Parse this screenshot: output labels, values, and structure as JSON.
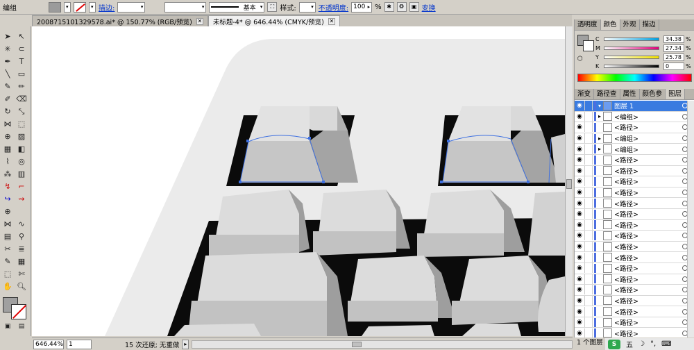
{
  "control_bar": {
    "selection_label": "编组",
    "stroke_label": "描边:",
    "stroke_profile": "基本",
    "style_label": "样式:",
    "opacity_label": "不透明度:",
    "opacity_value": "100",
    "percent": "%",
    "transform_label": "变换"
  },
  "doc_tabs": [
    {
      "title": "2008715101329578.ai* @ 150.77% (RGB/预览)",
      "active": false
    },
    {
      "title": "未标题-4* @ 646.44% (CMYK/预览)",
      "active": true
    }
  ],
  "color_panel": {
    "tabs": [
      "透明度",
      "颜色",
      "外观",
      "描边"
    ],
    "active_tab": "颜色",
    "channels": [
      {
        "name": "C",
        "value": "34.38",
        "color": "#00a0e0"
      },
      {
        "name": "M",
        "value": "27.34",
        "color": "#e0007a"
      },
      {
        "name": "Y",
        "value": "25.78",
        "color": "#f0e000"
      },
      {
        "name": "K",
        "value": "0",
        "color": "#000000"
      }
    ],
    "pct": "%"
  },
  "layers_panel": {
    "tabs": [
      "渐变",
      "路径查",
      "属性",
      "颜色参",
      "图层"
    ],
    "active_tab": "图层",
    "rows": [
      {
        "name": "图层 1",
        "selected": true
      },
      {
        "name": "<编组>",
        "selected": false
      },
      {
        "name": "<路径>",
        "selected": false
      },
      {
        "name": "<编组>",
        "selected": false
      },
      {
        "name": "<编组>",
        "selected": false
      },
      {
        "name": "<路径>",
        "selected": false
      },
      {
        "name": "<路径>",
        "selected": false
      },
      {
        "name": "<路径>",
        "selected": false
      },
      {
        "name": "<路径>",
        "selected": false
      },
      {
        "name": "<路径>",
        "selected": false
      },
      {
        "name": "<路径>",
        "selected": false
      },
      {
        "name": "<路径>",
        "selected": false
      },
      {
        "name": "<路径>",
        "selected": false
      },
      {
        "name": "<路径>",
        "selected": false
      },
      {
        "name": "<路径>",
        "selected": false
      },
      {
        "name": "<路径>",
        "selected": false
      },
      {
        "name": "<路径>",
        "selected": false
      },
      {
        "name": "<路径>",
        "selected": false
      },
      {
        "name": "<路径>",
        "selected": false
      },
      {
        "name": "<路径>",
        "selected": false
      },
      {
        "name": "<路径>",
        "selected": false
      },
      {
        "name": "<路径>",
        "selected": false
      }
    ],
    "footer": "1 个图层"
  },
  "status_bar": {
    "zoom": "646.44%",
    "page": "1",
    "history": "15 次还原; 无重做"
  },
  "ime": {
    "logo": "S",
    "mode": "五"
  },
  "colors": {
    "chrome": "#d4d0c8",
    "selection_blue": "#3a7be0",
    "key_light": "#dcdcdc",
    "key_mid": "#c2c2c2",
    "key_dark": "#9e9e9e",
    "well": "#0b0b0b",
    "path_handle": "#3d6fe0"
  }
}
